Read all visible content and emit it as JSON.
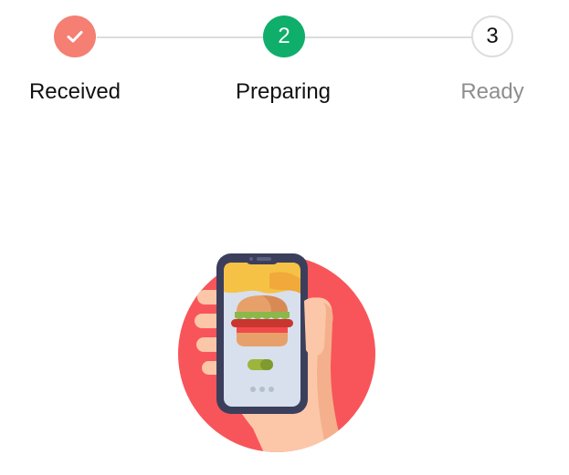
{
  "steps": [
    {
      "label": "Received",
      "state": "completed",
      "icon": "check-icon",
      "color": "#f47f72"
    },
    {
      "label": "Preparing",
      "state": "active",
      "number": "2",
      "color": "#0fae6b"
    },
    {
      "label": "Ready",
      "state": "pending",
      "number": "3",
      "color": "#8e8e8e"
    }
  ],
  "illustration": {
    "icon": "phone-burger-order-icon",
    "background_color": "#f8555a"
  }
}
